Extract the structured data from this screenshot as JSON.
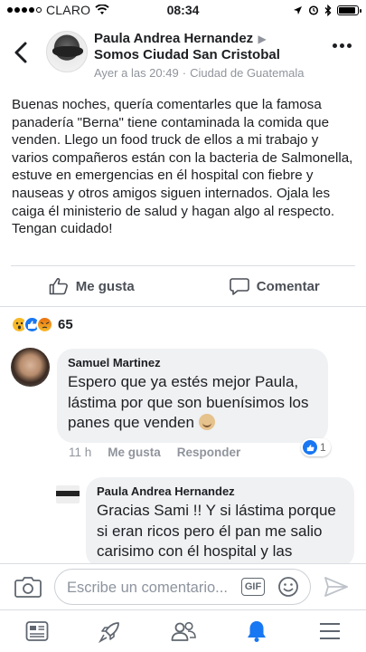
{
  "status_bar": {
    "carrier": "CLARO",
    "time": "08:34",
    "signal_bars": 4,
    "battery_level": 0.92
  },
  "post": {
    "author": "Paula Andrea Hernandez",
    "group": "Somos Ciudad San Cristobal",
    "timestamp": "Ayer a las 20:49",
    "separator": "·",
    "location": "Ciudad de Guatemala",
    "body": [
      "Buenas noches, quería comentarles que la famosa panadería \"Berna\" tiene contaminada la comida que venden. Llego un food truck de ellos a mi trabajo y varios compañeros están con la bacteria de Salmonella, estuve en emergencias en él hospital con fiebre y nauseas y otros amigos siguen internados. Ojala les caiga él ministerio de salud y hagan algo al respecto.",
      "Tengan cuidado!"
    ]
  },
  "actions": {
    "like_label": "Me gusta",
    "comment_label": "Comentar"
  },
  "reactions": {
    "types": [
      "wow-icon",
      "like-icon",
      "angry-icon"
    ],
    "count": "65"
  },
  "comments": [
    {
      "author": "Samuel Martinez",
      "text": "Espero que ya estés mejor Paula, lástima por que son buenísimos los panes que venden",
      "time": "11 h",
      "like_label": "Me gusta",
      "reply_label": "Responder",
      "like_count": "1"
    },
    {
      "author": "Paula Andrea Hernandez",
      "text": "Gracias Sami !! Y si lástima porque si eran ricos pero él pan me salio carisimo con él hospital y las"
    }
  ],
  "composer": {
    "placeholder": "Escribe un comentario...",
    "gif_label": "GIF"
  },
  "bottom_nav": [
    "news-feed-icon",
    "explore-rocket-icon",
    "groups-icon",
    "notifications-bell-icon",
    "menu-icon"
  ],
  "colors": {
    "accent": "#1877f2",
    "muted_text": "#90949c",
    "bubble_bg": "#eff1f3"
  }
}
